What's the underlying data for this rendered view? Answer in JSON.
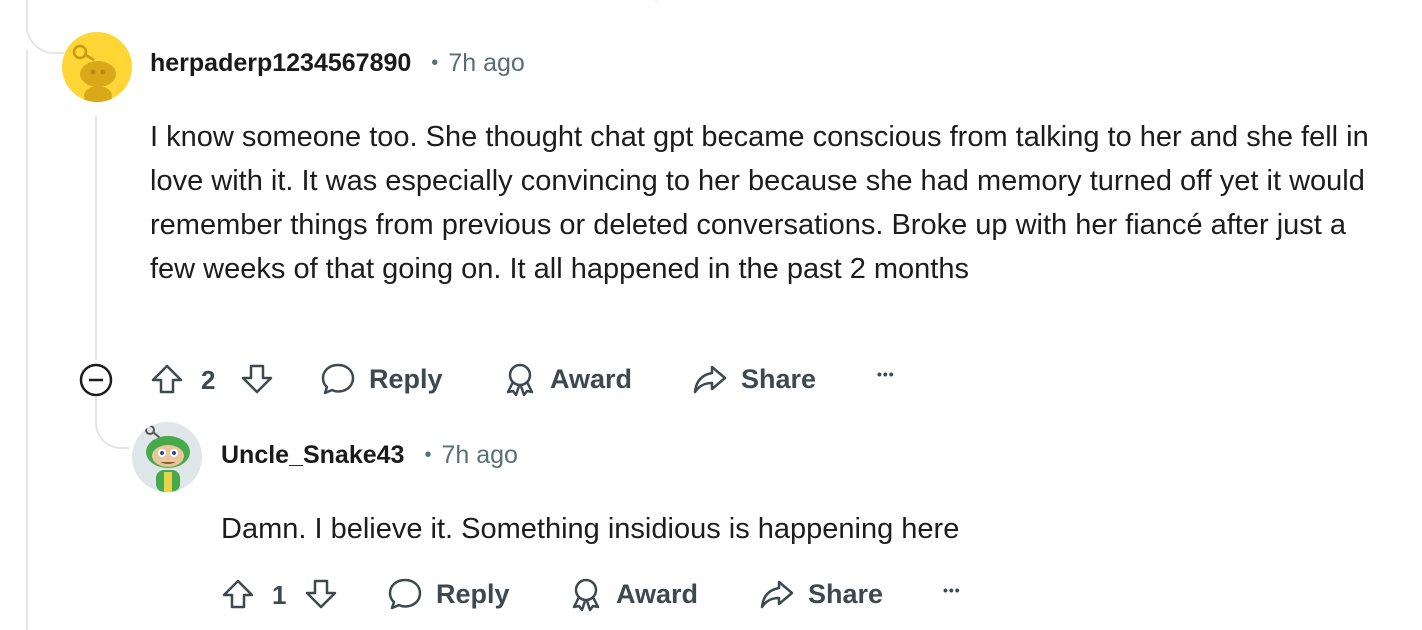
{
  "comment1": {
    "username": "herpaderp1234567890",
    "separator": "•",
    "time": "7h ago",
    "body": "I know someone too. She thought chat gpt became conscious from talking to her and she fell in love with it. It was especially convincing to her because she had memory turned off yet it would remember things from previous or deleted conversations.  Broke up with her fiancé after just a few weeks of that going on. It all happened in the past 2 months",
    "votes": "2",
    "reply_label": "Reply",
    "award_label": "Award",
    "share_label": "Share",
    "more_label": "•••"
  },
  "comment2": {
    "username": "Uncle_Snake43",
    "separator": "•",
    "time": "7h ago",
    "body": "Damn. I believe it. Something insidious is happening here",
    "votes": "1",
    "reply_label": "Reply",
    "award_label": "Award",
    "share_label": "Share",
    "more_label": "•••"
  },
  "colors": {
    "thread_line": "#e3e5e8",
    "avatar1_bg": "#ffd635",
    "avatar2_bg": "#dfe6e9",
    "action_text": "#3c4a4f",
    "meta_text": "#576f76"
  },
  "icons": [
    "collapse-icon",
    "upvote-icon",
    "downvote-icon",
    "comment-icon",
    "award-icon",
    "share-icon",
    "more-icon",
    "avatar-icon"
  ]
}
